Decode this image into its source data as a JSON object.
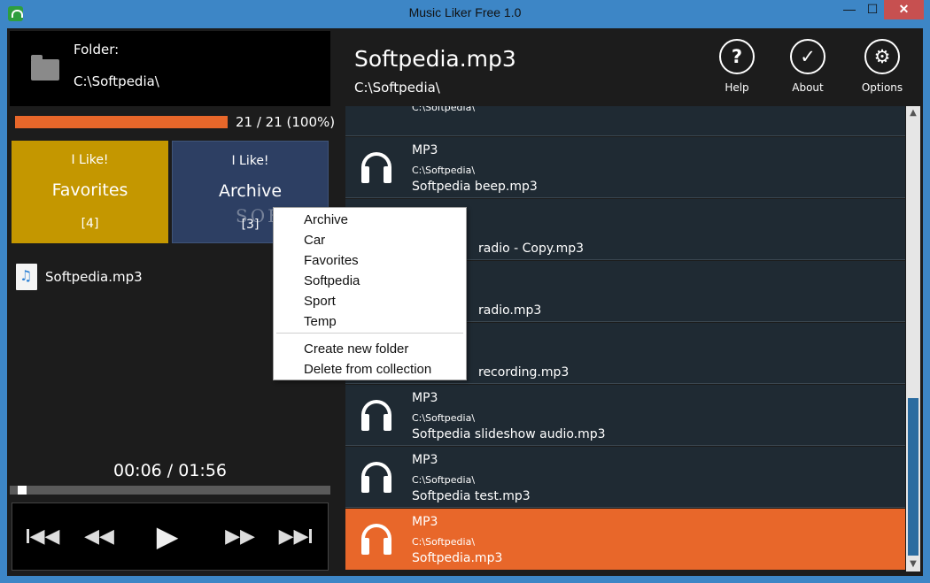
{
  "window": {
    "title": "Music Liker Free 1.0",
    "min": "—",
    "max": "☐",
    "close": "✕"
  },
  "folder": {
    "label": "Folder:",
    "path": "C:\\Softpedia\\"
  },
  "progress": {
    "text": "21 / 21 (100%)",
    "fraction": 1.0
  },
  "tiles": [
    {
      "top": "I Like!",
      "name": "Favorites",
      "count": "[4]",
      "color": "#c49700"
    },
    {
      "top": "I Like!",
      "name": "Archive",
      "count": "[3]",
      "color": "#2d3f63"
    }
  ],
  "current_file": {
    "name": "Softpedia.mp3"
  },
  "player": {
    "time": "00:06 / 01:56",
    "position_fraction": 0.052
  },
  "header": {
    "title": "Softpedia.mp3",
    "path": "C:\\Softpedia\\",
    "buttons": [
      {
        "label": "Help",
        "glyph": "?"
      },
      {
        "label": "About",
        "glyph": "✓"
      },
      {
        "label": "Options",
        "glyph": "⚙"
      }
    ]
  },
  "list": {
    "partial_path": "C:\\Softpedia\\",
    "rows": [
      {
        "type": "MP3",
        "path": "C:\\Softpedia\\",
        "name": "Softpedia beep.mp3",
        "selected": false
      },
      {
        "type": "",
        "path": "",
        "name": "radio - Copy.mp3",
        "selected": false
      },
      {
        "type": "",
        "path": "",
        "name": "radio.mp3",
        "selected": false
      },
      {
        "type": "",
        "path": "",
        "name": "recording.mp3",
        "selected": false
      },
      {
        "type": "MP3",
        "path": "C:\\Softpedia\\",
        "name": "Softpedia slideshow audio.mp3",
        "selected": false
      },
      {
        "type": "MP3",
        "path": "C:\\Softpedia\\",
        "name": "Softpedia test.mp3",
        "selected": false
      },
      {
        "type": "MP3",
        "path": "C:\\Softpedia\\",
        "name": "Softpedia.mp3",
        "selected": true
      }
    ]
  },
  "watermark": "SOFTP",
  "context_menu": {
    "folders": [
      "Archive",
      "Car",
      "Favorites",
      "Softpedia",
      "Sport",
      "Temp"
    ],
    "actions": [
      "Create new folder",
      "Delete from collection"
    ]
  },
  "colors": {
    "accent": "#e8672a",
    "favorites": "#c49700",
    "archive": "#2d3f63",
    "titlebar": "#3d86c6"
  }
}
